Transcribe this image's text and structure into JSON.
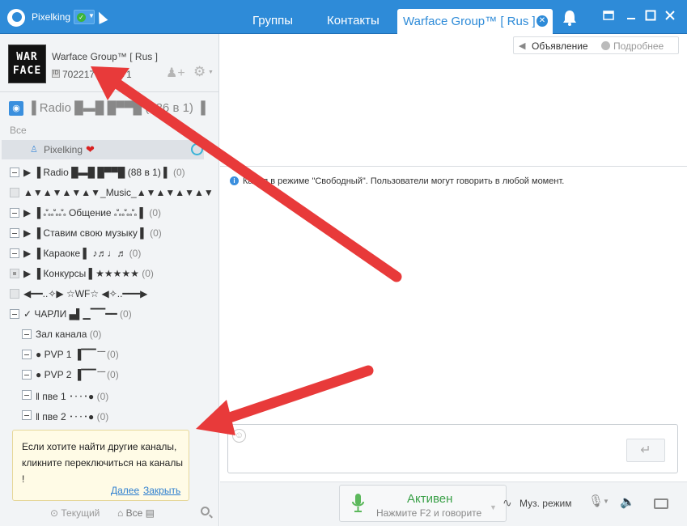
{
  "titlebar": {
    "user": "Pixelking",
    "tabs": [
      "Группы",
      "Контакты"
    ],
    "active_tab": "Warface Group™ [ Rus ]"
  },
  "channel": {
    "logo_text": "WAR FACE",
    "name": "Warface Group™ [ Rus ]",
    "id": "702217",
    "members": "1"
  },
  "list": {
    "radio_top": "▐ Radio █▬█ █▀▀█ (186 в 1) ▐",
    "all_label": "Все",
    "current_user": "Pixelking",
    "rows": [
      {
        "text": "▶ ▐ Radio █▬█ █▀▀█ (88 в 1) ▌",
        "count": "(0)",
        "type": "chk"
      },
      {
        "text": "▲▼▲▼▲▼▲▼_Music_▲▼▲▼▲▼▲▼",
        "count": "",
        "type": "dis"
      },
      {
        "text": "▶ ▐ ஃஃஃ Общение ஃஃஃ ▌",
        "count": "(0)",
        "type": "chk"
      },
      {
        "text": "▶ ▐ Ставим свою музыку ▌",
        "count": "(0)",
        "type": "chk"
      },
      {
        "text": "▶ ▐ Караоке ▌ ♪♬♩♬",
        "count": "(0)",
        "type": "chk"
      },
      {
        "text": "▶ ▐ Конкурсы ▌★★★★★",
        "count": "(0)",
        "type": "lock"
      },
      {
        "text": "◀━━..✧▶ ☆WF☆ ◀✧..━━━▶",
        "count": "",
        "type": "dis"
      },
      {
        "text": "✓ ЧАРЛИ ▄▌▁▔▔━━",
        "count": "(0)",
        "type": "chk"
      }
    ],
    "sub_rows": [
      {
        "text": "Зал канала",
        "count": "(0)"
      },
      {
        "text": "● PVP 1  ▐▔▔ ̄ ̄ ̄",
        "count": "(0)"
      },
      {
        "text": "● PVP 2  ▐▔▔ ̄ ̄ ̄",
        "count": "(0)"
      },
      {
        "text": "‖ пве 1 ･‥･●",
        "count": "(0)"
      },
      {
        "text": "‖ пве 2 ･‥･●",
        "count": "(0)"
      }
    ]
  },
  "tooltip": {
    "text": "Если хотите найти другие каналы, кликните переключиться на каналы !",
    "more": "Далее",
    "close": "Закрыть"
  },
  "left_footer": {
    "current": "Текущий",
    "all": "Все"
  },
  "right": {
    "announce": "Объявление",
    "details": "Подробнее",
    "info": "Канал в режиме \"Свободный\". Пользователи могут говорить в любой момент."
  },
  "bottom": {
    "status": "Активен",
    "hint": "Нажмите F2 и говорите",
    "music_mode": "Муз. режим"
  },
  "colors": {
    "accent": "#2e8bd8",
    "arrow": "#e83a3a",
    "active_green": "#3aa048"
  }
}
